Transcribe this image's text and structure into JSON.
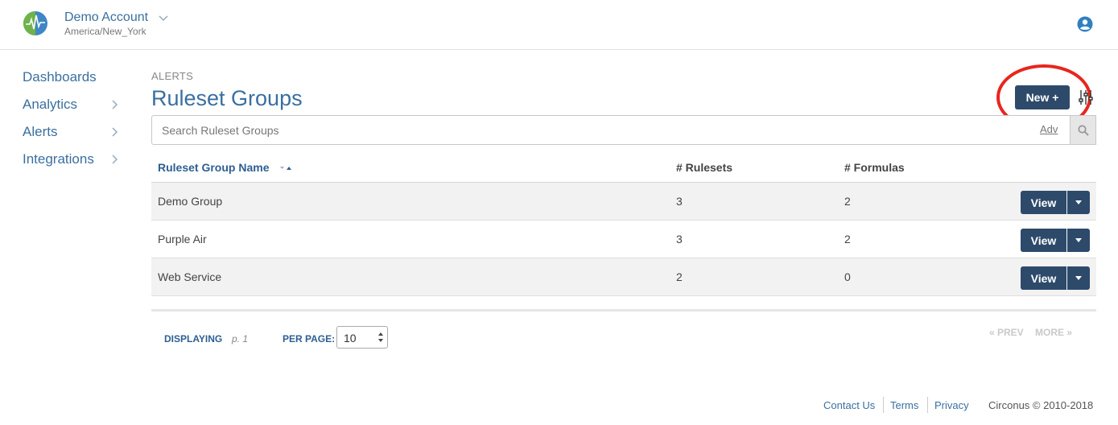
{
  "header": {
    "account_name": "Demo Account",
    "timezone": "America/New_York"
  },
  "sidebar": {
    "items": [
      {
        "label": "Dashboards",
        "has_children": false
      },
      {
        "label": "Analytics",
        "has_children": true
      },
      {
        "label": "Alerts",
        "has_children": true
      },
      {
        "label": "Integrations",
        "has_children": true
      }
    ]
  },
  "main": {
    "breadcrumb": "ALERTS",
    "title": "Ruleset Groups",
    "new_button": "New +",
    "search": {
      "placeholder": "Search Ruleset Groups",
      "adv_label": "Adv"
    },
    "table": {
      "columns": [
        "Ruleset Group Name",
        "# Rulesets",
        "# Formulas"
      ],
      "rows": [
        {
          "name": "Demo Group",
          "rulesets": "3",
          "formulas": "2",
          "action": "View"
        },
        {
          "name": "Purple Air",
          "rulesets": "3",
          "formulas": "2",
          "action": "View"
        },
        {
          "name": "Web Service",
          "rulesets": "2",
          "formulas": "0",
          "action": "View"
        }
      ]
    },
    "pagination": {
      "displaying_label": "DISPLAYING",
      "page": "p. 1",
      "per_page_label": "PER PAGE:",
      "per_page_value": "10",
      "prev_label": "« PREV",
      "more_label": "MORE »"
    }
  },
  "footer": {
    "links": [
      "Contact Us",
      "Terms",
      "Privacy"
    ],
    "copyright": "Circonus © 2010-2018"
  },
  "colors": {
    "primary": "#2d4a6b",
    "link": "#3a6fa0",
    "highlight": "#e8261d"
  }
}
